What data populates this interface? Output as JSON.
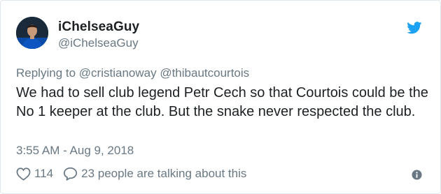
{
  "tweet": {
    "author_name": "iChelseaGuy",
    "author_handle": "@iChelseaGuy",
    "replying_prefix": "Replying to",
    "replying_to": [
      "@cristianoway",
      "@thibautcourtois"
    ],
    "text": "We had to sell club legend Petr Cech so that Courtois could be the No 1 keeper at the club. But the snake never respected the club.",
    "timestamp": "3:55 AM - Aug 9, 2018",
    "like_count": "114",
    "talking_text": "23 people are talking about this"
  },
  "icons": {
    "brand": "twitter-bird-icon",
    "like": "heart-icon",
    "reply": "speech-bubble-icon",
    "info": "info-icon"
  },
  "colors": {
    "twitter_blue": "#1da1f2",
    "secondary_text": "#697882",
    "primary_text": "#1c2022",
    "avatar_kit": "#0b4aa6"
  }
}
